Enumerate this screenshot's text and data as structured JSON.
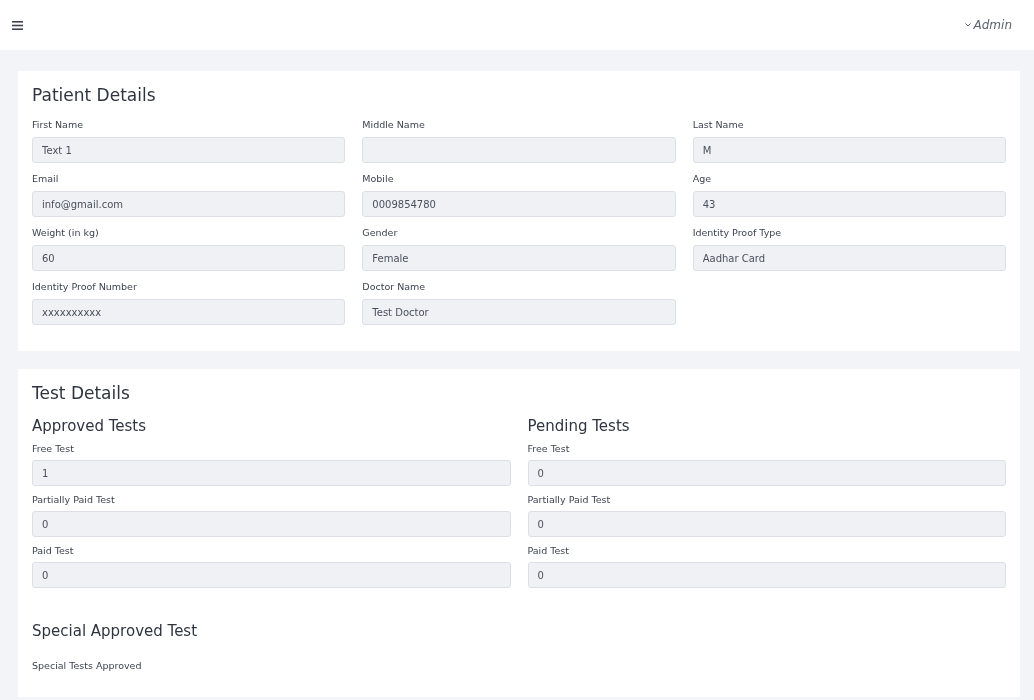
{
  "header": {
    "user": "Admin"
  },
  "patient_details": {
    "title": "Patient Details",
    "fields": [
      {
        "label": "First Name",
        "value": "Text 1"
      },
      {
        "label": "Middle Name"
      },
      {
        "label": "Last Name",
        "value": "M"
      },
      {
        "label": "Email",
        "value": "info@gmail.com"
      },
      {
        "label": "Mobile",
        "value": "0009854780"
      },
      {
        "label": "Age",
        "value": "43"
      },
      {
        "label": "Weight (in kg)",
        "value": "60"
      },
      {
        "label": "Gender",
        "value": "Female"
      },
      {
        "label": "Identity Proof Type",
        "value": "Aadhar Card"
      },
      {
        "label": "Identity Proof Number",
        "value": "xxxxxxxxxx"
      },
      {
        "label": "Doctor Name",
        "value": "Test Doctor"
      }
    ]
  },
  "test_details": {
    "title": "Test Details",
    "groups": [
      {
        "title": "Approved Tests",
        "fields": [
          {
            "label": "Free Test",
            "value": "1"
          },
          {
            "label": "Partially Paid Test",
            "value": "0"
          },
          {
            "label": "Paid Test",
            "value": "0"
          }
        ]
      },
      {
        "title": "Pending Tests",
        "fields": [
          {
            "label": "Free Test",
            "value": "0"
          },
          {
            "label": "Partially Paid Test",
            "value": "0"
          },
          {
            "label": "Paid Test",
            "value": "0"
          }
        ]
      }
    ],
    "special": {
      "title": "Special Approved Test",
      "label": "Special Tests Approved"
    }
  }
}
